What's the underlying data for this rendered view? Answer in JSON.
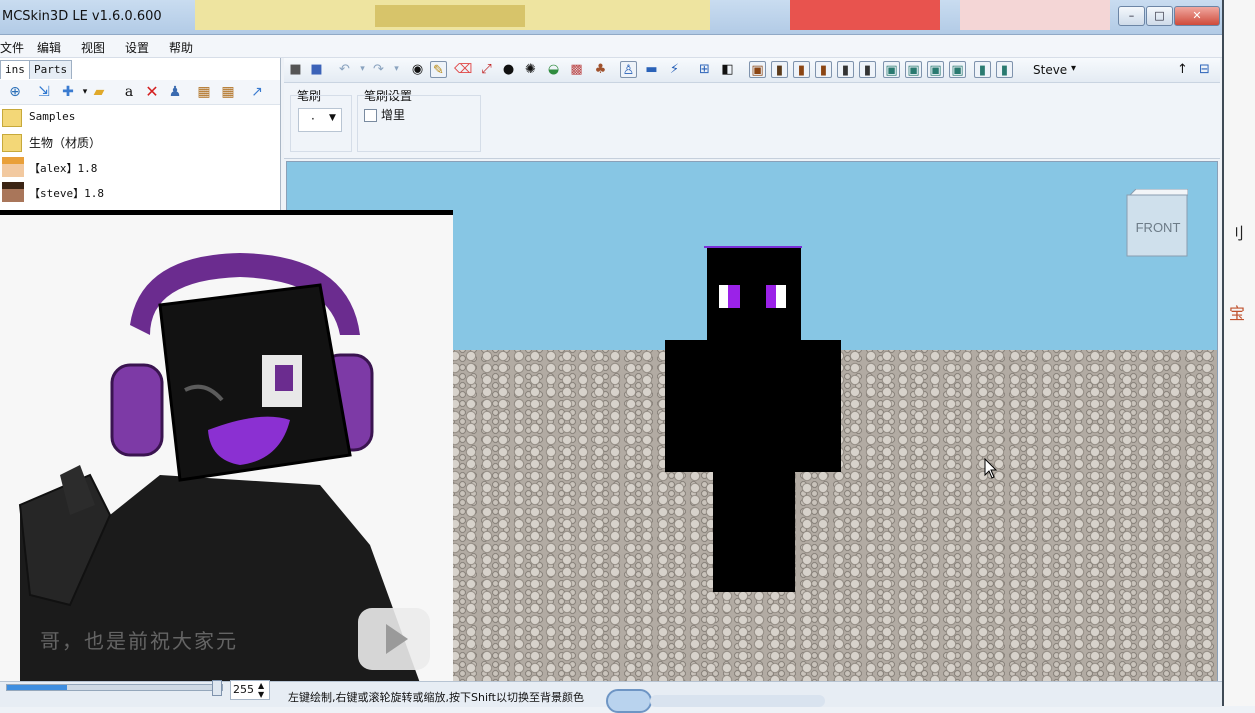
{
  "window": {
    "title": "MCSkin3D LE v1.6.0.600",
    "controls": {
      "minimize": "–",
      "maximize": "□",
      "close": "✕"
    }
  },
  "menu": [
    "文件",
    "编辑",
    "视图",
    "设置",
    "帮助"
  ],
  "left_panel": {
    "tabs": [
      "ins",
      "Parts"
    ],
    "tree": [
      {
        "label": "Samples",
        "icon": "folder-icon"
      },
      {
        "label": "生物（材质）",
        "icon": "folder-icon"
      },
      {
        "label": "【alex】1.8",
        "icon": "alex-skin-icon"
      },
      {
        "label": "【steve】1.8",
        "icon": "steve-skin-icon"
      }
    ]
  },
  "main_toolbar": {
    "model_selector": "Steve",
    "model_selector_arrow": "▾"
  },
  "brush_panel": {
    "brush_label": "笔刷",
    "brush_value": "·",
    "brush_settings_label": "笔刷设置",
    "incremental_label": "增里",
    "incremental_checked": false
  },
  "viewport": {
    "cube_label": "FRONT",
    "colors": {
      "sky": "#87c6e4",
      "ground": "#b2aba3",
      "skin_body": "#000000",
      "eyes": "#9b22e8"
    }
  },
  "overlay": {
    "subtitle": "哥，也是前祝大家元",
    "video_play_icon": "play-icon"
  },
  "bottom": {
    "slider_value": "255",
    "status_text": "左键绘制,右键或滚轮旋转或缩放,按下Shift以切换至背景颜色"
  }
}
